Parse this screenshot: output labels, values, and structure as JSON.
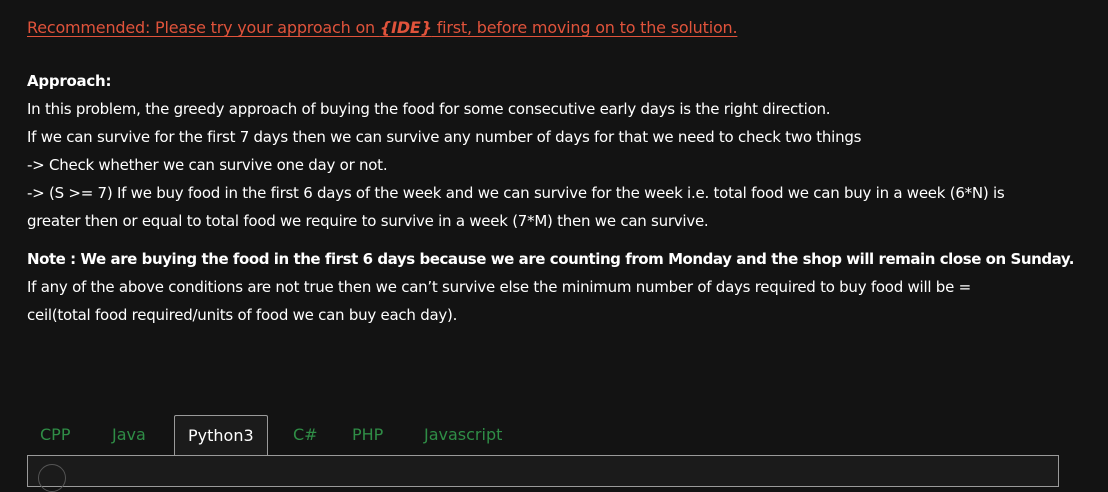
{
  "recommendation": {
    "prefix": "Recommended: Please try your approach on ",
    "ide_label": "{IDE}",
    "suffix": " first, before moving on to the solution."
  },
  "approach": {
    "heading": "Approach:",
    "lines": [
      "In this problem, the greedy approach of buying the food for some consecutive early days is the right direction.",
      "If we can survive for the first 7 days then we can survive any number of days for that we need to check two things",
      "-> Check whether we can survive one day or not.",
      "-> (S >= 7) If we buy food in the first 6 days of the week and we can survive for the week i.e. total food we can buy in a week (6*N) is",
      "greater then or equal to total food we require to survive in a week (7*M) then we can survive."
    ],
    "note": "Note : We are buying the food in the first 6 days because we are counting from Monday and the shop will remain close on Sunday.",
    "conclusion_lines": [
      "If any of the above conditions are not true then we can’t survive else the minimum number of days required to buy food will be =",
      "ceil(total food required/units of food we can buy each day)."
    ]
  },
  "tabs": [
    {
      "label": "CPP"
    },
    {
      "label": "Java"
    },
    {
      "label": "Python3"
    },
    {
      "label": "C#"
    },
    {
      "label": "PHP"
    },
    {
      "label": "Javascript"
    }
  ],
  "active_tab": "Python3",
  "colors": {
    "background": "#131313",
    "link": "#e0533b",
    "tab_inactive": "#2f8d46",
    "tab_active_text": "#ffffff",
    "border": "#9a9a9a"
  }
}
